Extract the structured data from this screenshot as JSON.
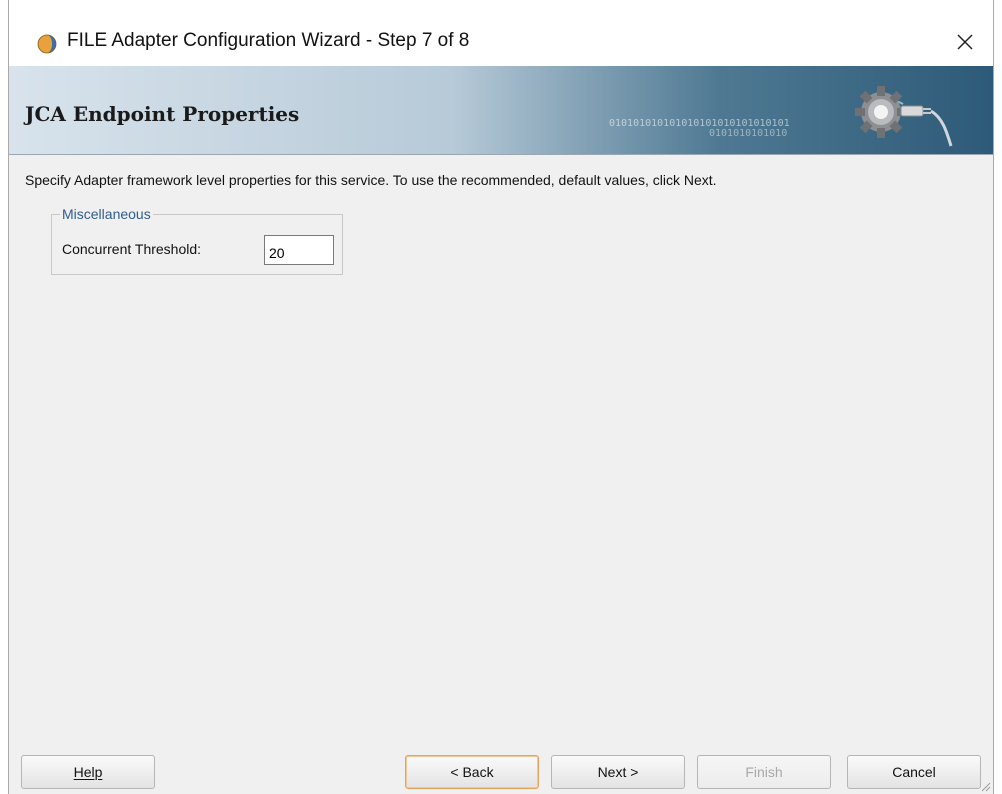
{
  "window": {
    "title": "FILE Adapter Configuration Wizard - Step 7 of 8",
    "close_symbol": "✕"
  },
  "banner": {
    "title": "JCA Endpoint Properties",
    "binary_line1": "010101010101010101010101010101",
    "binary_line2": "0101010101010",
    "icon": "gear-plug-icon"
  },
  "content": {
    "instruction": "Specify Adapter framework level properties for this service.  To use the recommended, default values, click Next.",
    "group": {
      "legend": "Miscellaneous",
      "fields": [
        {
          "label": "Concurrent Threshold:",
          "value": "20"
        }
      ]
    }
  },
  "buttons": {
    "help": {
      "label": "Help",
      "mnemonic": "H"
    },
    "back": {
      "label": "< Back",
      "mnemonic": "B"
    },
    "next": {
      "label": "Next >",
      "mnemonic": "N"
    },
    "finish": {
      "label": "Finish",
      "mnemonic": "F",
      "enabled": false
    },
    "cancel": {
      "label": "Cancel"
    }
  },
  "colors": {
    "accent": "#2f5c8f",
    "focus_border": "#e8a15c"
  }
}
